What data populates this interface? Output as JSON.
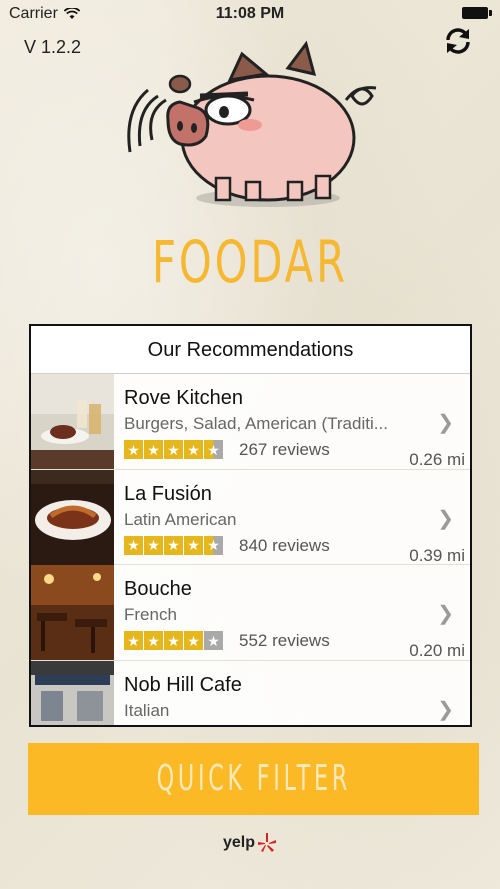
{
  "status": {
    "carrier": "Carrier",
    "time": "11:08 PM"
  },
  "app": {
    "version": "V 1.2.2",
    "title": "FOODAR"
  },
  "panel": {
    "header": "Our Recommendations",
    "restaurants": [
      {
        "name": "Rove Kitchen",
        "categories": "Burgers, Salad, American (Traditi...",
        "rating": 4.5,
        "reviews": "267 reviews",
        "distance": "0.26 mi"
      },
      {
        "name": "La Fusión",
        "categories": "Latin American",
        "rating": 4.5,
        "reviews": "840 reviews",
        "distance": "0.39 mi"
      },
      {
        "name": "Bouche",
        "categories": "French",
        "rating": 4.0,
        "reviews": "552 reviews",
        "distance": "0.20 mi"
      },
      {
        "name": "Nob Hill Cafe",
        "categories": "Italian",
        "rating": null,
        "reviews": "",
        "distance": ""
      }
    ]
  },
  "quick_filter": {
    "label": "QUICK FILTER"
  },
  "footer": {
    "brand": "yelp"
  },
  "icons": {
    "refresh": "refresh-icon",
    "chevron": "chevron-right-icon",
    "wifi": "wifi-icon",
    "battery": "battery-icon",
    "star": "star-icon"
  },
  "colors": {
    "accent": "#fbb926",
    "title": "#f6b731",
    "star": "#e6b71d",
    "star_empty": "#a9a9a9",
    "yelp_red": "#d32323"
  }
}
